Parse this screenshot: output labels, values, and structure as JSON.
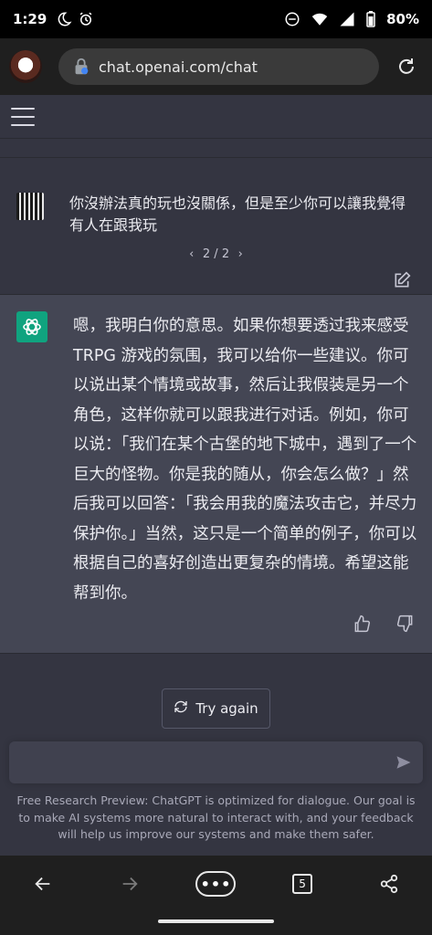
{
  "status_bar": {
    "time": "1:29",
    "icons": [
      "moon-icon",
      "alarm-icon",
      "dnd-icon",
      "wifi-icon",
      "signal-icon",
      "battery-icon"
    ],
    "battery": "80%"
  },
  "browser": {
    "url": "chat.openai.com/chat",
    "profile_icon": "avatar-icon",
    "reload_icon": "reload-icon"
  },
  "header": {
    "menu_icon": "hamburger-icon"
  },
  "conversation": {
    "user_message": "你沒辦法真的玩也沒關係，但是至少你可以讓我覺得有人在跟我玩",
    "pager": {
      "prev": "‹",
      "label": "2 / 2",
      "next": "›"
    },
    "assistant_message": "嗯，我明白你的意思。如果你想要透过我来感受 TRPG 游戏的氛围，我可以给你一些建议。你可以说出某个情境或故事，然后让我假装是另一个角色，这样你就可以跟我进行对话。例如，你可以说：「我们在某个古堡的地下城中，遇到了一个巨大的怪物。你是我的随从，你会怎么做？」然后我可以回答：「我会用我的魔法攻击它，并尽力保护你。」当然，这只是一个简单的例子，你可以根据自己的喜好创造出更复杂的情境。希望这能帮到你。"
  },
  "actions": {
    "try_again": "Try again"
  },
  "composer": {
    "placeholder": "",
    "disclaimer": "Free Research Preview: ChatGPT is optimized for dialogue. Our goal is to make AI systems more natural to interact with, and your feedback will help us improve our systems and make them safer."
  },
  "bottom_nav": {
    "menu_label": "•••",
    "tab_count": "5"
  },
  "colors": {
    "bg": "#343541",
    "assistant_bg": "#444654",
    "input_bg": "#40414f",
    "openai_green": "#10a37f"
  }
}
